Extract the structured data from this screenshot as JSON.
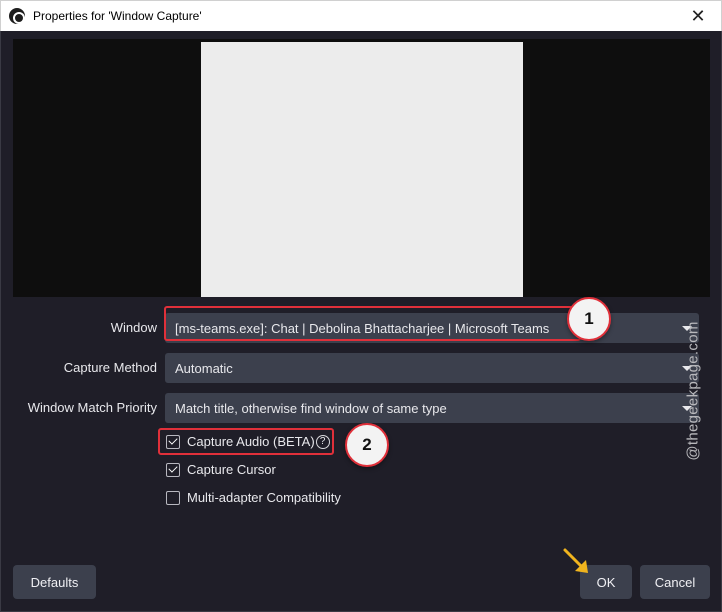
{
  "window": {
    "title": "Properties for 'Window Capture'",
    "close_glyph": "✕"
  },
  "fields": {
    "window": {
      "label": "Window",
      "value": "[ms-teams.exe]: Chat | Debolina Bhattacharjee | Microsoft Teams"
    },
    "capture_method": {
      "label": "Capture Method",
      "value": "Automatic"
    },
    "match_priority": {
      "label": "Window Match Priority",
      "value": "Match title, otherwise find window of same type"
    }
  },
  "checkboxes": [
    {
      "label": "Capture Audio (BETA)",
      "checked": true,
      "help_glyph": "?"
    },
    {
      "label": "Capture Cursor",
      "checked": true
    },
    {
      "label": "Multi-adapter Compatibility",
      "checked": false
    }
  ],
  "annotations": {
    "badge_1": "1",
    "badge_2": "2"
  },
  "buttons": {
    "defaults": "Defaults",
    "ok": "OK",
    "cancel": "Cancel"
  },
  "watermark": "@thegeekpage.com",
  "colors": {
    "dialog_bg": "#1f1e28",
    "control_bg": "#3c404d",
    "highlight": "#e0303a",
    "pointer": "#f0b41e"
  }
}
